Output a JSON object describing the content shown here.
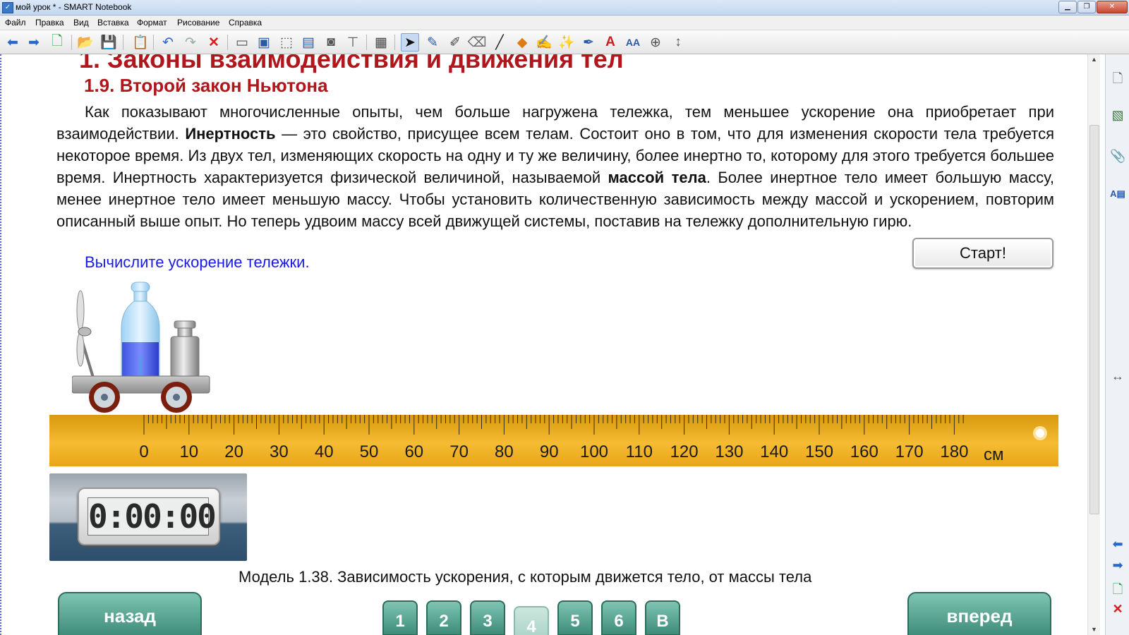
{
  "window": {
    "title": "мой урок * - SMART Notebook"
  },
  "menu": [
    "Файл",
    "Правка",
    "Вид",
    "Вставка",
    "Формат",
    "Рисование",
    "Справка"
  ],
  "toolbar": {
    "icons": [
      "back-arrow-icon",
      "forward-arrow-icon",
      "add-page-icon",
      "open-folder-icon",
      "save-icon",
      "paste-icon",
      "undo-icon",
      "redo-icon",
      "delete-icon",
      "screen-shade-icon",
      "display-icon",
      "full-screen-icon",
      "transparent-bg-icon",
      "capture-icon",
      "dual-page-icon",
      "table-icon",
      "select-pointer-icon",
      "pen-icon",
      "creative-pen-icon",
      "eraser-icon",
      "line-icon",
      "shapes-icon",
      "fill-icon",
      "magic-pen-icon",
      "shape-recognition-pen-icon",
      "text-icon",
      "font-icon",
      "measure-icon",
      "move-toolbar-icon"
    ]
  },
  "page": {
    "chapter_title": "1. Законы взаимодействия и движения тел",
    "section_title": "1.9. Второй закон Ньютона",
    "paragraph": {
      "s1": "Как показывают многочисленные опыты, чем больше нагружена тележка, тем меньшее ускорение она приобретает при взаимодействии. ",
      "b1": "Инертность",
      "s2": " — это свойство, присущее всем телам. Состоит оно в том, что для изменения скорости тела требуется некоторое время. Из двух тел, изменяющих скорость на одну и ту же величину, более инертно то, которому для этого требуется большее время. Инертность характеризуется физической величиной, называемой ",
      "b2": "массой тела",
      "s3": ". Более инертное тело имеет большую массу, менее инертное тело имеет меньшую массу. Чтобы установить количественную зависимость между массой и ускорением, повторим описанный выше опыт. Но теперь удвоим массу всей движущей системы, поставив на тележку дополнительную гирю."
    },
    "task": "Вычислите ускорение тележки.",
    "start_button": "Старт!",
    "ruler": {
      "labels": [
        "0",
        "10",
        "20",
        "30",
        "40",
        "50",
        "60",
        "70",
        "80",
        "90",
        "100",
        "110",
        "120",
        "130",
        "140",
        "150",
        "160",
        "170",
        "180"
      ],
      "unit": "см"
    },
    "timer": "0:00:00",
    "caption": "Модель 1.38. Зависимость ускорения, с которым движется тело, от массы тела",
    "nav": {
      "back": "назад",
      "forward": "вперед",
      "pages": [
        "1",
        "2",
        "3",
        "4",
        "5",
        "6",
        "В"
      ],
      "current_page": "4"
    }
  }
}
